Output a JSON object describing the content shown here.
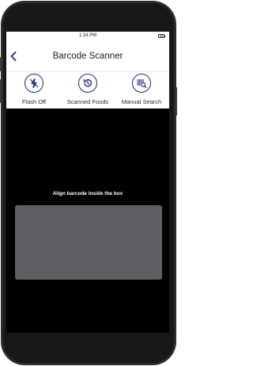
{
  "status_bar": {
    "time": "1:24 PM"
  },
  "header": {
    "title": "Barcode Scanner",
    "back_icon": "chevron-left-icon"
  },
  "toolbar": {
    "items": [
      {
        "label": "Flash Off",
        "icon": "flash-off-icon"
      },
      {
        "label": "Scanned Foods",
        "icon": "history-icon"
      },
      {
        "label": "Manual Search",
        "icon": "barcode-search-icon"
      }
    ]
  },
  "scanner": {
    "hint": "Align barcode inside the box"
  },
  "colors": {
    "accent": "#1b2a7a",
    "camera_bg": "#000000",
    "scan_box": "#5f5f63"
  }
}
